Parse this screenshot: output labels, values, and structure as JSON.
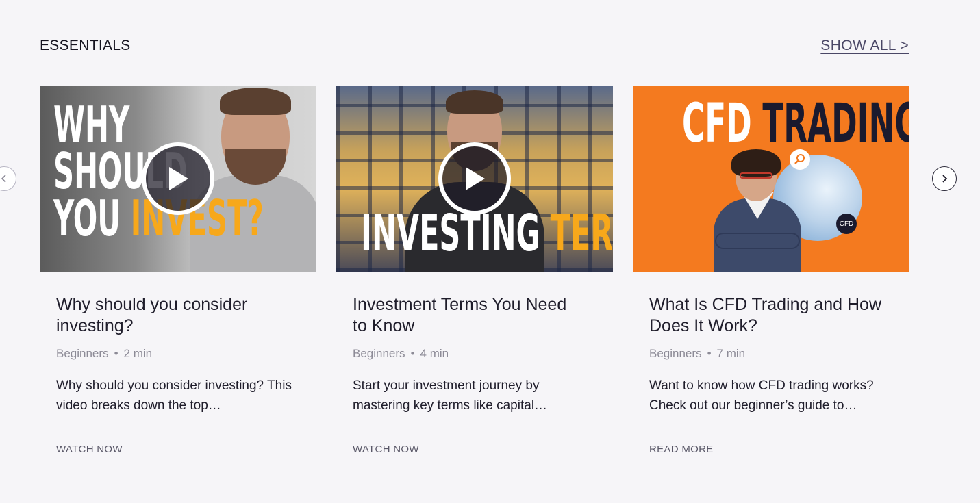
{
  "section": {
    "title": "ESSENTIALS",
    "show_all_label": "SHOW ALL >"
  },
  "carousel": {
    "prev_icon": "chevron-left-icon",
    "next_icon": "chevron-right-icon"
  },
  "cards": [
    {
      "thumbnail_text": [
        "WHY",
        "SHOULD",
        "YOU",
        "INVEST?"
      ],
      "title": "Why should you consider investing?",
      "category": "Beginners",
      "duration": "2 min",
      "description": "Why should you consider investing? This video breaks down the top…",
      "cta": "WATCH NOW"
    },
    {
      "thumbnail_text": [
        "INVESTING",
        "TERMS"
      ],
      "title": "Investment Terms You Need to Know",
      "category": "Beginners",
      "duration": "4 min",
      "description": "Start your investment journey by mastering key terms like capital…",
      "cta": "WATCH NOW"
    },
    {
      "thumbnail_text": [
        "CFD",
        "TRADING",
        "CFD"
      ],
      "title": "What Is CFD Trading and How Does It Work?",
      "category": "Beginners",
      "duration": "7 min",
      "description": "Want to know how CFD trading works? Check out our beginner’s guide to…",
      "cta": "READ MORE"
    }
  ],
  "colors": {
    "background": "#f6f5f8",
    "accent_yellow": "#f7a81b",
    "accent_orange": "#f47a1f",
    "link": "#4a4766"
  }
}
